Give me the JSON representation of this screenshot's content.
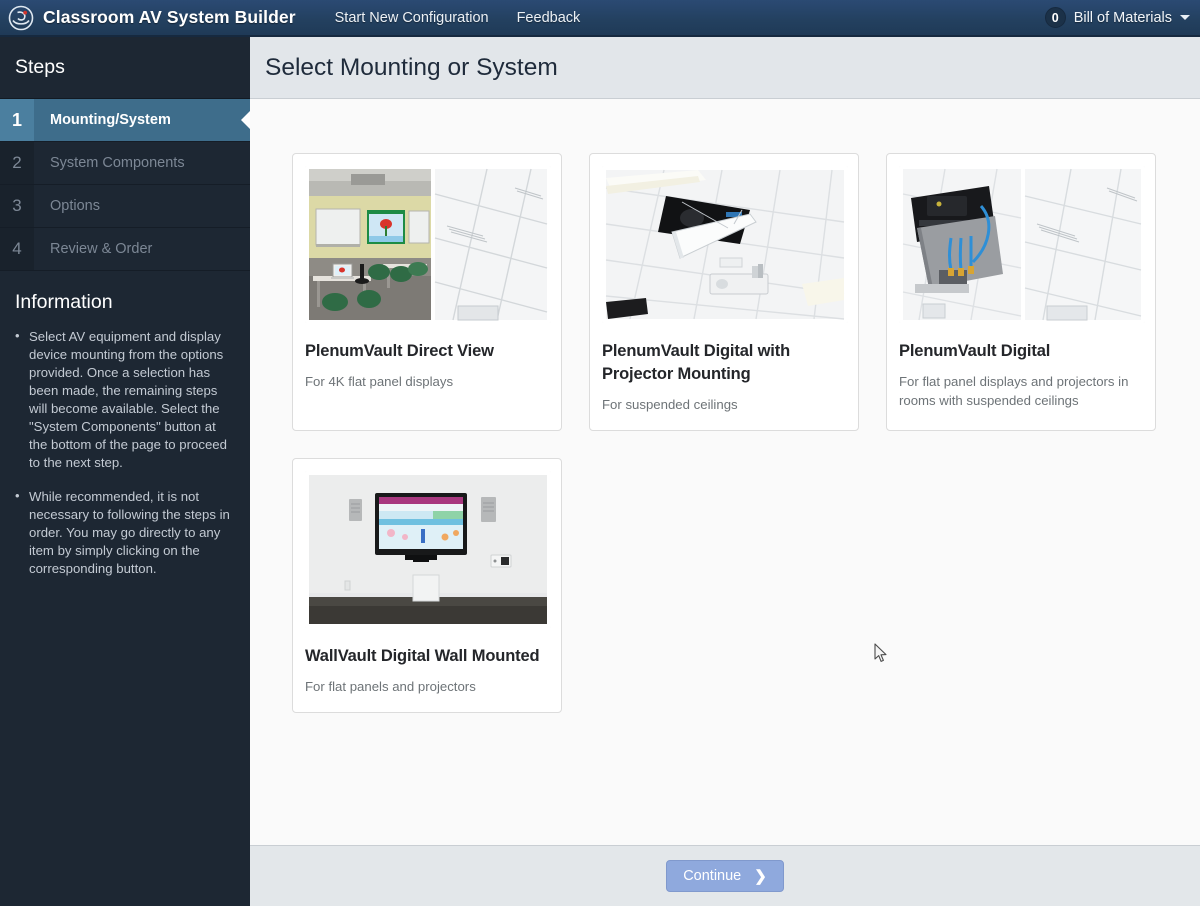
{
  "header": {
    "logo_icon": "company-globe-logo",
    "brand_title": "Classroom AV System Builder",
    "nav_links": [
      {
        "label": "Start New Configuration"
      },
      {
        "label": "Feedback"
      }
    ],
    "bom": {
      "count": "0",
      "label": "Bill of Materials",
      "caret_icon": "chevron-down-icon"
    }
  },
  "sidebar": {
    "title": "Steps",
    "steps": [
      {
        "num": "1",
        "label": "Mounting/System",
        "active": true
      },
      {
        "num": "2",
        "label": "System Components",
        "active": false
      },
      {
        "num": "3",
        "label": "Options",
        "active": false
      },
      {
        "num": "4",
        "label": "Review & Order",
        "active": false
      }
    ],
    "info": {
      "title": "Information",
      "items": [
        "Select AV equipment and display device mounting from the options provided. Once a selection has been made, the remaining steps will become available. Select the \"System Components\" button at the bottom of the page to proceed to the next step.",
        "While recommended, it is not necessary to following the steps in order. You may go directly to any item by simply clicking on the corresponding button."
      ]
    }
  },
  "main": {
    "page_title": "Select Mounting or System",
    "cards": [
      {
        "title": "PlenumVault Direct View",
        "subtitle": "For 4K flat panel displays",
        "image_alt": "classroom-with-whiteboards-and-ceiling-tiles"
      },
      {
        "title": "PlenumVault Digital with Projector Mounting",
        "subtitle": "For suspended ceilings",
        "image_alt": "suspended-ceiling-with-open-vault-and-projector"
      },
      {
        "title": "PlenumVault Digital",
        "subtitle": "For flat panel displays and projectors in rooms with suspended ceilings",
        "image_alt": "open-plenum-vault-with-cables-and-ceiling-tiles"
      },
      {
        "title": "WallVault Digital Wall Mounted",
        "subtitle": "For flat panels and projectors",
        "image_alt": "wall-mounted-flat-panel-display-with-speakers"
      }
    ]
  },
  "footer": {
    "continue_label": "Continue",
    "continue_chevron": "chevron-right-icon",
    "continue_enabled": false
  },
  "colors": {
    "nav_blue": "#23405f",
    "sidebar_dark": "#1d2733",
    "step_active": "#3e6d8b",
    "header_gray": "#e2e6ea",
    "button_blue": "#8fa9dd"
  }
}
